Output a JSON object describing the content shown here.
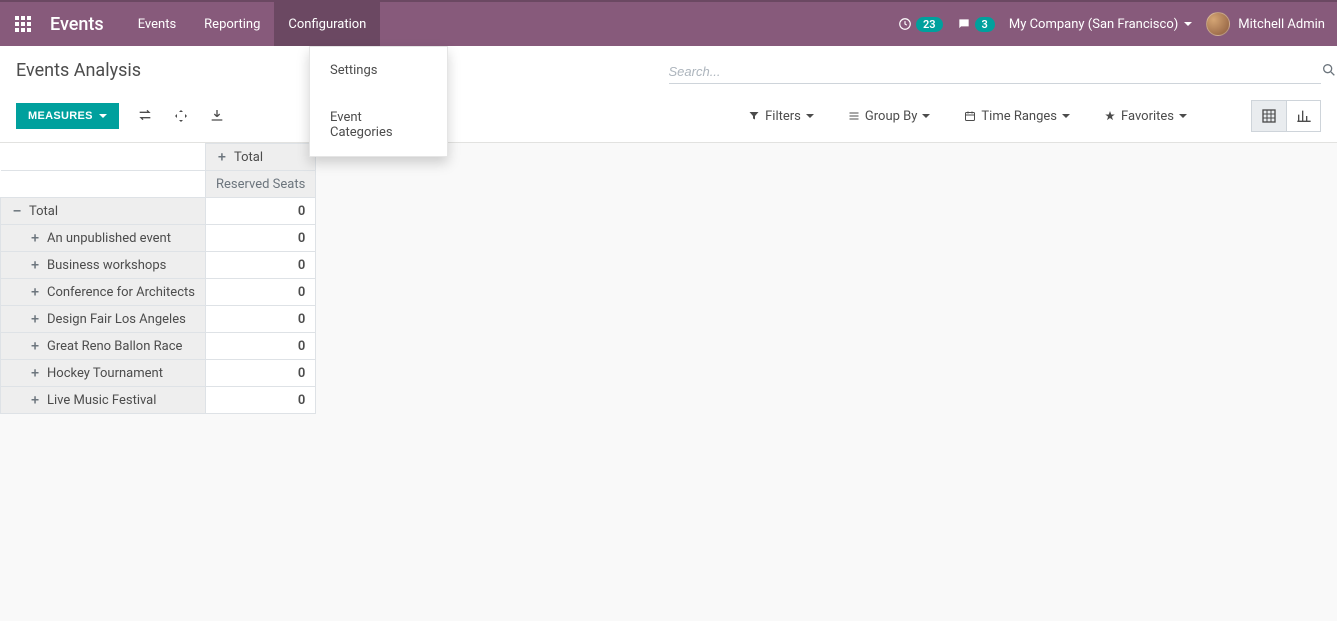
{
  "nav": {
    "brand": "Events",
    "items": [
      "Events",
      "Reporting",
      "Configuration"
    ],
    "active_index": 2,
    "dropdown": [
      "Settings",
      "Event Categories"
    ]
  },
  "topright": {
    "conversations_count": "23",
    "messages_count": "3",
    "company": "My Company (San Francisco)",
    "user": "Mitchell Admin"
  },
  "control_panel": {
    "title": "Events Analysis",
    "search_placeholder": "Search...",
    "measures_label": "MEASURES",
    "filters_label": "Filters",
    "groupby_label": "Group By",
    "timeranges_label": "Time Ranges",
    "favorites_label": "Favorites"
  },
  "pivot": {
    "col_header": "Total",
    "measure_header": "Reserved Seats",
    "total_label": "Total",
    "total_value": "0",
    "rows": [
      {
        "label": "An unpublished event",
        "value": "0"
      },
      {
        "label": "Business workshops",
        "value": "0"
      },
      {
        "label": "Conference for Architects",
        "value": "0"
      },
      {
        "label": "Design Fair Los Angeles",
        "value": "0"
      },
      {
        "label": "Great Reno Ballon Race",
        "value": "0"
      },
      {
        "label": "Hockey Tournament",
        "value": "0"
      },
      {
        "label": "Live Music Festival",
        "value": "0"
      }
    ]
  }
}
